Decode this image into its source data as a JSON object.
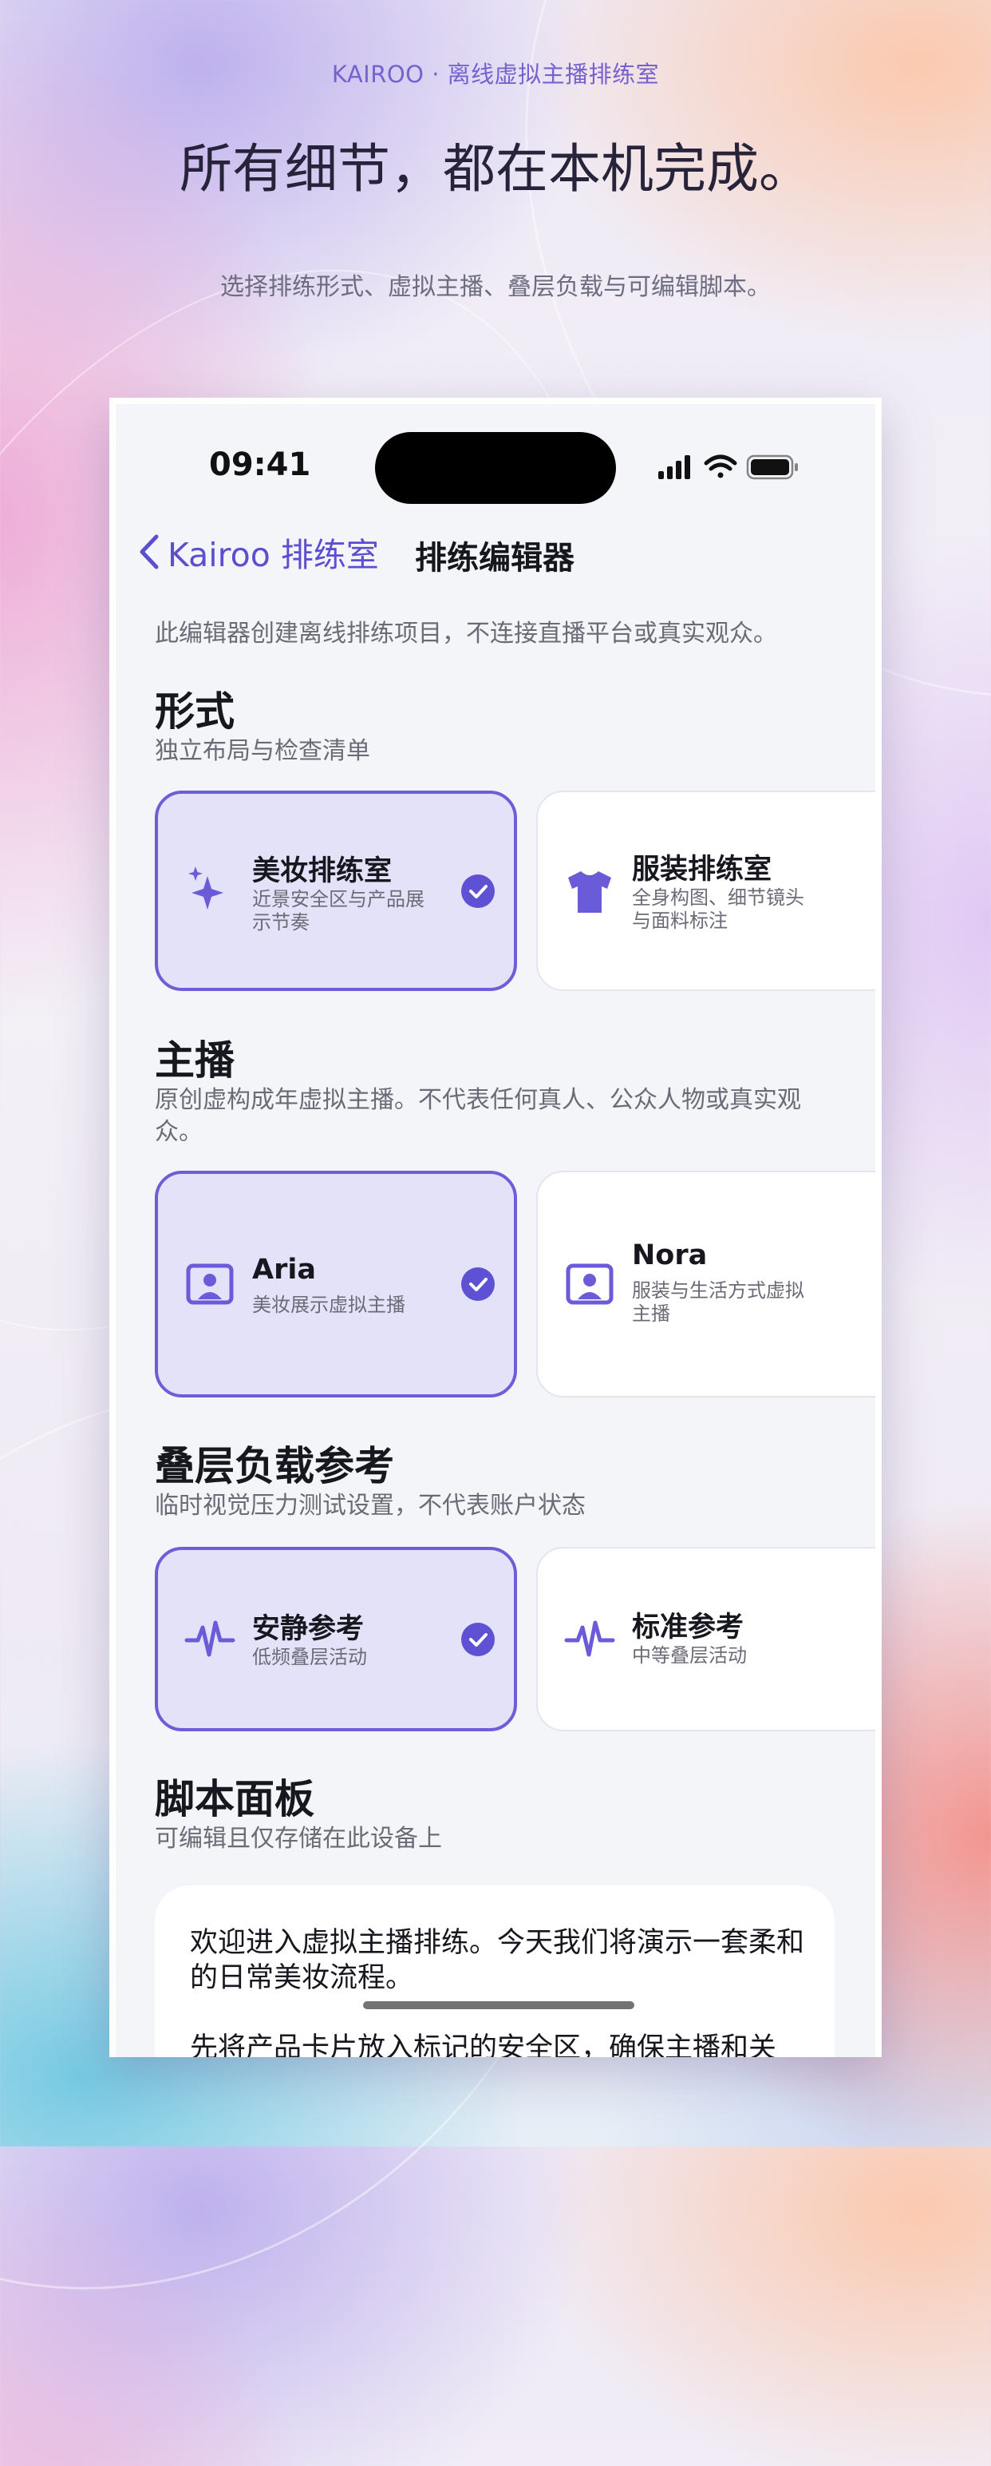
{
  "header": {
    "brand": "KAIROO · 离线虚拟主播排练室",
    "title": "所有细节，都在本机完成。",
    "subtitle": "选择排练形式、虚拟主播、叠层负载与可编辑脚本。"
  },
  "status_bar": {
    "time": "09:41",
    "icons": [
      "cellular-signal-icon",
      "wifi-icon",
      "battery-icon"
    ]
  },
  "nav": {
    "back_label": "Kairoo 排练室",
    "title": "排练编辑器"
  },
  "note": "此编辑器创建离线排练项目，不连接直播平台或真实观众。",
  "sections": [
    {
      "title": "形式",
      "subtitle": "独立布局与检查清单",
      "options": [
        {
          "title": "美妆排练室",
          "desc": "近景安全区与产品展示节奏",
          "icon": "sparkles-icon",
          "selected": true
        },
        {
          "title": "服装排练室",
          "desc": "全身构图、细节镜头与面料标注",
          "icon": "tshirt-icon",
          "selected": false
        }
      ]
    },
    {
      "title": "主播",
      "subtitle": "原创虚构成年虚拟主播。不代表任何真人、公众人物或真实观众。",
      "options": [
        {
          "title": "Aria",
          "desc": "美妆展示虚拟主播",
          "icon": "portrait-icon",
          "selected": true
        },
        {
          "title": "Nora",
          "desc": "服装与生活方式虚拟主播",
          "icon": "portrait-icon",
          "selected": false
        }
      ]
    },
    {
      "title": "叠层负载参考",
      "subtitle": "临时视觉压力测试设置，不代表账户状态",
      "options": [
        {
          "title": "安静参考",
          "desc": "低频叠层活动",
          "icon": "waveform-icon",
          "selected": true
        },
        {
          "title": "标准参考",
          "desc": "中等叠层活动",
          "icon": "waveform-icon",
          "selected": false
        }
      ]
    },
    {
      "title": "脚本面板",
      "subtitle": "可编辑且仅存储在此设备上"
    }
  ],
  "script": {
    "paragraph1": "欢迎进入虚拟主播排练。今天我们将演示一套柔和的日常美妆流程。",
    "paragraph2": "先将产品卡片放入标记的安全区，确保主播和关"
  },
  "colors": {
    "accent": "#5f51d3",
    "selected_bg": "#e3e2f8",
    "screen_bg": "#f4f5f9"
  }
}
